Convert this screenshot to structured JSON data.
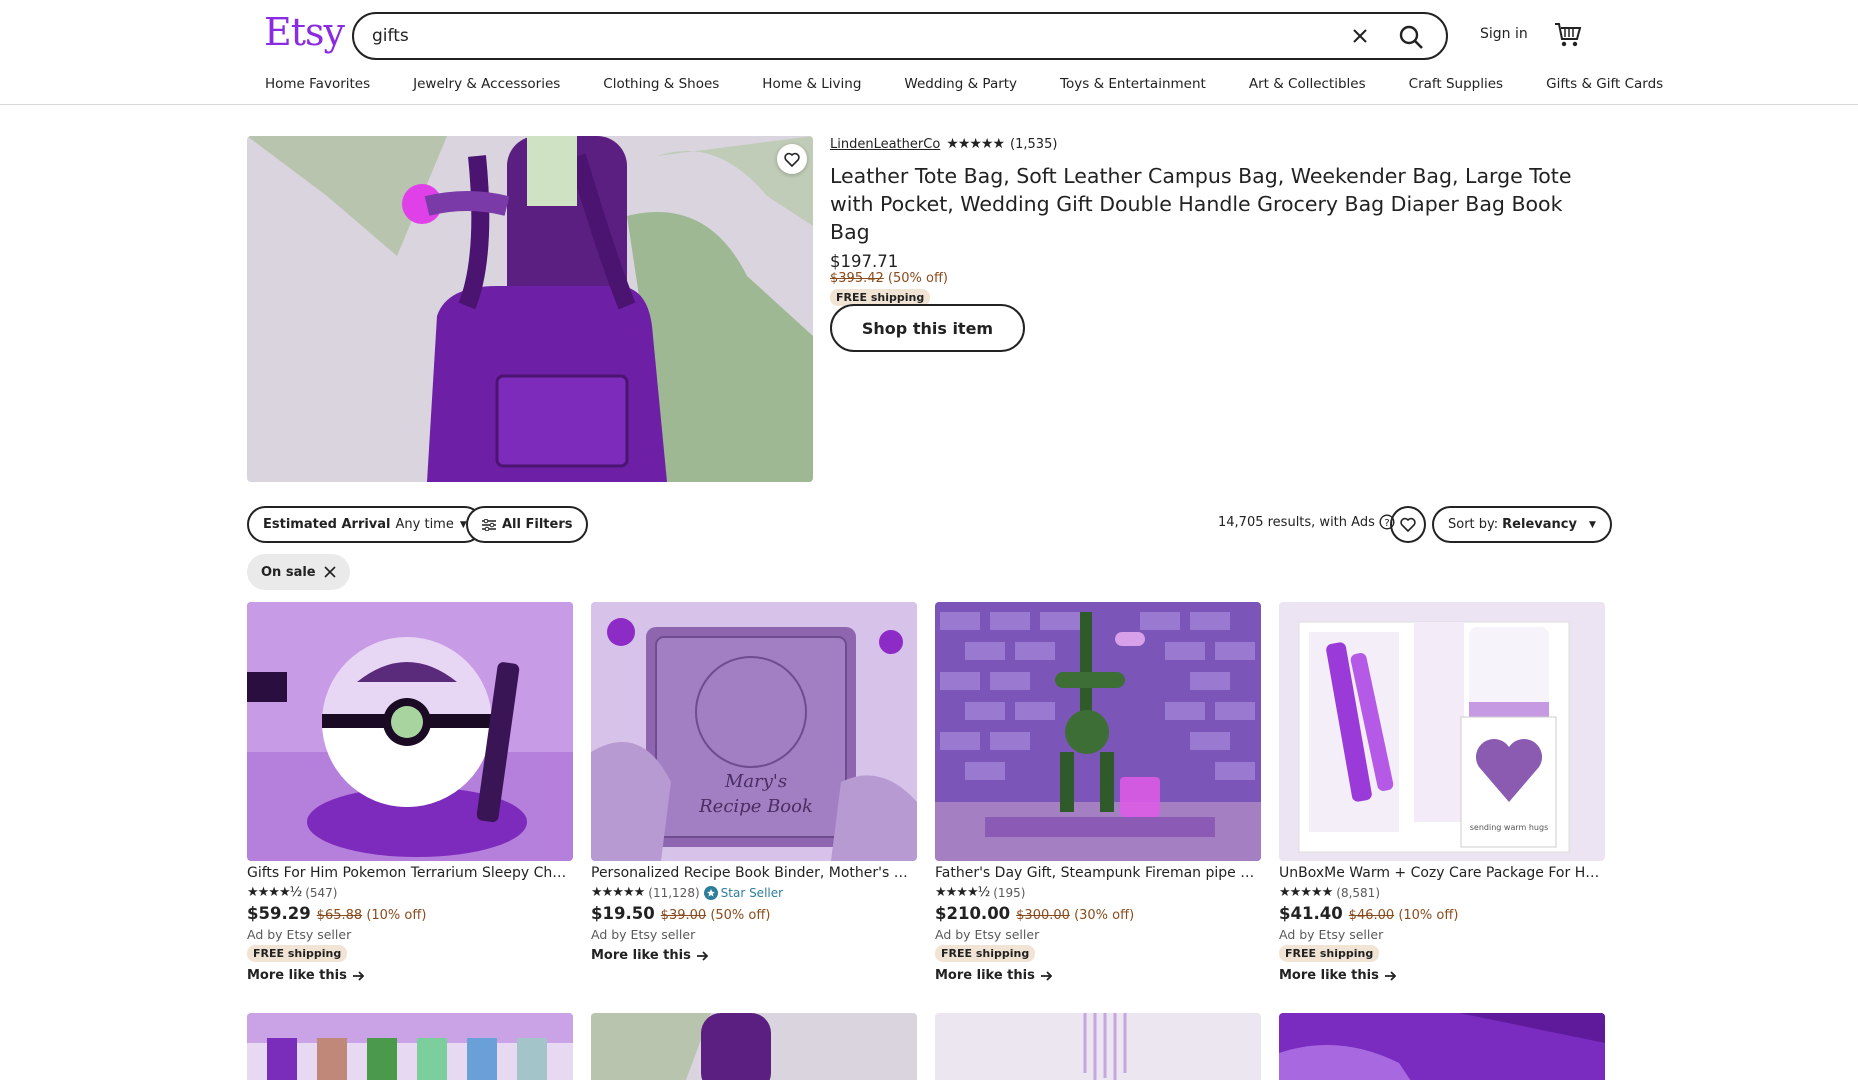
{
  "header": {
    "logo": "Etsy",
    "search_value": "gifts",
    "sign_in": "Sign in",
    "categories": [
      "Home Favorites",
      "Jewelry & Accessories",
      "Clothing & Shoes",
      "Home & Living",
      "Wedding & Party",
      "Toys & Entertainment",
      "Art & Collectibles",
      "Craft Supplies",
      "Gifts & Gift Cards"
    ]
  },
  "featured": {
    "shop_name": "LindenLeatherCo",
    "stars": "★★★★★",
    "review_count": "(1,535)",
    "title": "Leather Tote Bag, Soft Leather Campus Bag, Weekender Bag, Large Tote with Pocket, Wedding Gift Double Handle Grocery Bag Diaper Bag Book Bag",
    "price": "$197.71",
    "original_price": "$395.42",
    "discount": "(50% off)",
    "free_shipping": "FREE shipping",
    "shop_button": "Shop this item"
  },
  "filters": {
    "arrival_label": "Estimated Arrival",
    "arrival_value": "Any time",
    "all_filters": "All Filters",
    "results_text": "14,705 results, with Ads",
    "sort_label": "Sort by:",
    "sort_value": "Relevancy",
    "active_chip": "On sale"
  },
  "listings": [
    {
      "title": "Gifts For Him Pokemon Terrarium Sleepy Charmander",
      "stars": "★★★★½",
      "reviews": "(547)",
      "price": "$59.29",
      "original_price": "$65.88",
      "discount": "(10% off)",
      "ad_text": "Ad by Etsy seller",
      "free_shipping": "FREE shipping",
      "more": "More like this"
    },
    {
      "title": "Personalized Recipe Book Binder, Mother's Day Gift",
      "stars": "★★★★★",
      "reviews": "(11,128)",
      "star_seller": "Star Seller",
      "price": "$19.50",
      "original_price": "$39.00",
      "discount": "(50% off)",
      "ad_text": "Ad by Etsy seller",
      "more": "More like this"
    },
    {
      "title": "Father's Day Gift, Steampunk Fireman pipe Robot",
      "stars": "★★★★½",
      "reviews": "(195)",
      "price": "$210.00",
      "original_price": "$300.00",
      "discount": "(30% off)",
      "ad_text": "Ad by Etsy seller",
      "free_shipping": "FREE shipping",
      "more": "More like this"
    },
    {
      "title": "UnBoxMe Warm + Cozy Care Package For Her, Self Care Gift",
      "stars": "★★★★★",
      "reviews": "(8,581)",
      "price": "$41.40",
      "original_price": "$46.00",
      "discount": "(10% off)",
      "ad_text": "Ad by Etsy seller",
      "free_shipping": "FREE shipping",
      "more": "More like this"
    }
  ],
  "colors": {
    "brand": "#8a2be2",
    "strike_price": "#8a4b1d",
    "free_shipping_bg": "#f1e4d5",
    "star_seller": "#2e7d9a"
  }
}
